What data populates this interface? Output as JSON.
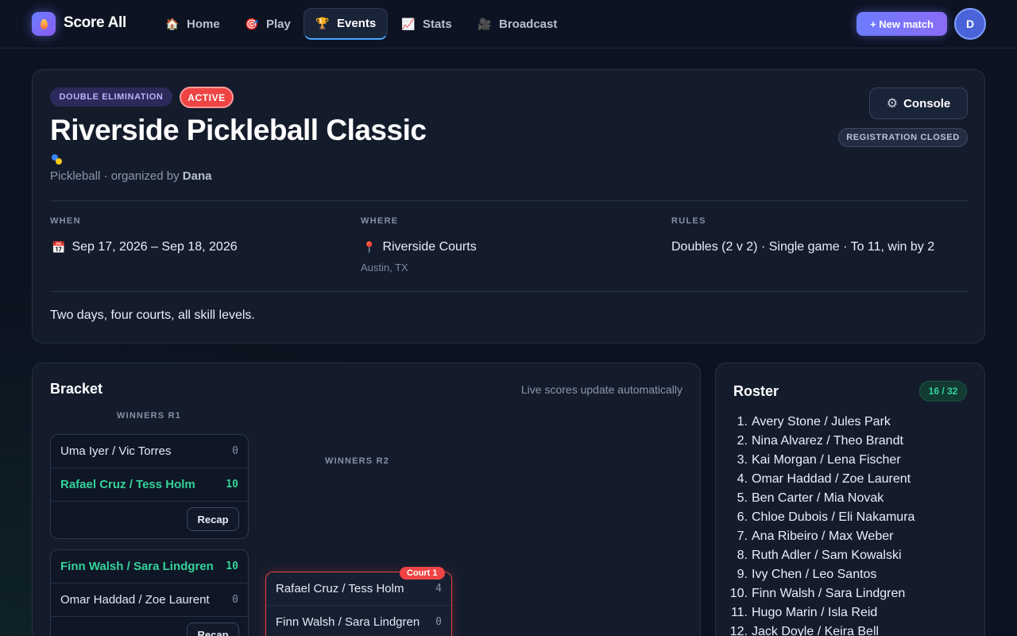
{
  "app": {
    "brand": "Score All"
  },
  "nav": {
    "items": [
      {
        "label": "Home",
        "icon": "🏠"
      },
      {
        "label": "Play",
        "icon": "🎯"
      },
      {
        "label": "Events",
        "icon": "🏆"
      },
      {
        "label": "Stats",
        "icon": "📈"
      },
      {
        "label": "Broadcast",
        "icon": "🎥"
      }
    ],
    "active": "Events",
    "new_match_label": "+ New match",
    "avatar_initial": "D"
  },
  "event": {
    "format_badge": "DOUBLE ELIMINATION",
    "status_badge": "ACTIVE",
    "title": "Riverside Pickleball Classic",
    "sport": "Pickleball",
    "organized_by_text": "organized by",
    "organizer": "Dana",
    "console_label": "Console",
    "registration_status": "REGISTRATION CLOSED",
    "when_label": "WHEN",
    "when_value": "Sep 17, 2026 – Sep 18, 2026",
    "where_label": "WHERE",
    "where_value": "Riverside Courts",
    "where_sub": "Austin, TX",
    "rules_label": "RULES",
    "rules_value": "Doubles (2 v 2) · Single game · To 11, win by 2",
    "description": "Two days, four courts, all skill levels."
  },
  "bracket": {
    "title": "Bracket",
    "note": "Live scores update automatically",
    "rounds": [
      {
        "label": "WINNERS R1",
        "matches": [
          {
            "teams": [
              {
                "name": "Uma Iyer / Vic Torres",
                "score": "0",
                "winner": false
              },
              {
                "name": "Rafael Cruz / Tess Holm",
                "score": "10",
                "winner": true
              }
            ],
            "action": "Recap"
          },
          {
            "teams": [
              {
                "name": "Finn Walsh / Sara Lindgren",
                "score": "10",
                "winner": true
              },
              {
                "name": "Omar Haddad / Zoe Laurent",
                "score": "0",
                "winner": false
              }
            ],
            "action": "Recap"
          }
        ]
      },
      {
        "label": "WINNERS R2",
        "matches": [
          {
            "court": "Court 1",
            "live": true,
            "teams": [
              {
                "name": "Rafael Cruz / Tess Holm",
                "score": "4",
                "winner": false
              },
              {
                "name": "Finn Walsh / Sara Lindgren",
                "score": "0",
                "winner": false
              }
            ]
          }
        ]
      }
    ]
  },
  "roster": {
    "title": "Roster",
    "count": "16 / 32",
    "teams": [
      "Avery Stone / Jules Park",
      "Nina Alvarez / Theo Brandt",
      "Kai Morgan / Lena Fischer",
      "Omar Haddad / Zoe Laurent",
      "Ben Carter / Mia Novak",
      "Chloe Dubois / Eli Nakamura",
      "Ana Ribeiro / Max Weber",
      "Ruth Adler / Sam Kowalski",
      "Ivy Chen / Leo Santos",
      "Finn Walsh / Sara Lindgren",
      "Hugo Marin / Isla Reid",
      "Jack Doyle / Keira Bell"
    ]
  },
  "colors": {
    "background": "#0c1220",
    "card": "#141c2c",
    "accent": "#6c7cff",
    "active_red": "#ef4444",
    "winner_green": "#34d399"
  }
}
